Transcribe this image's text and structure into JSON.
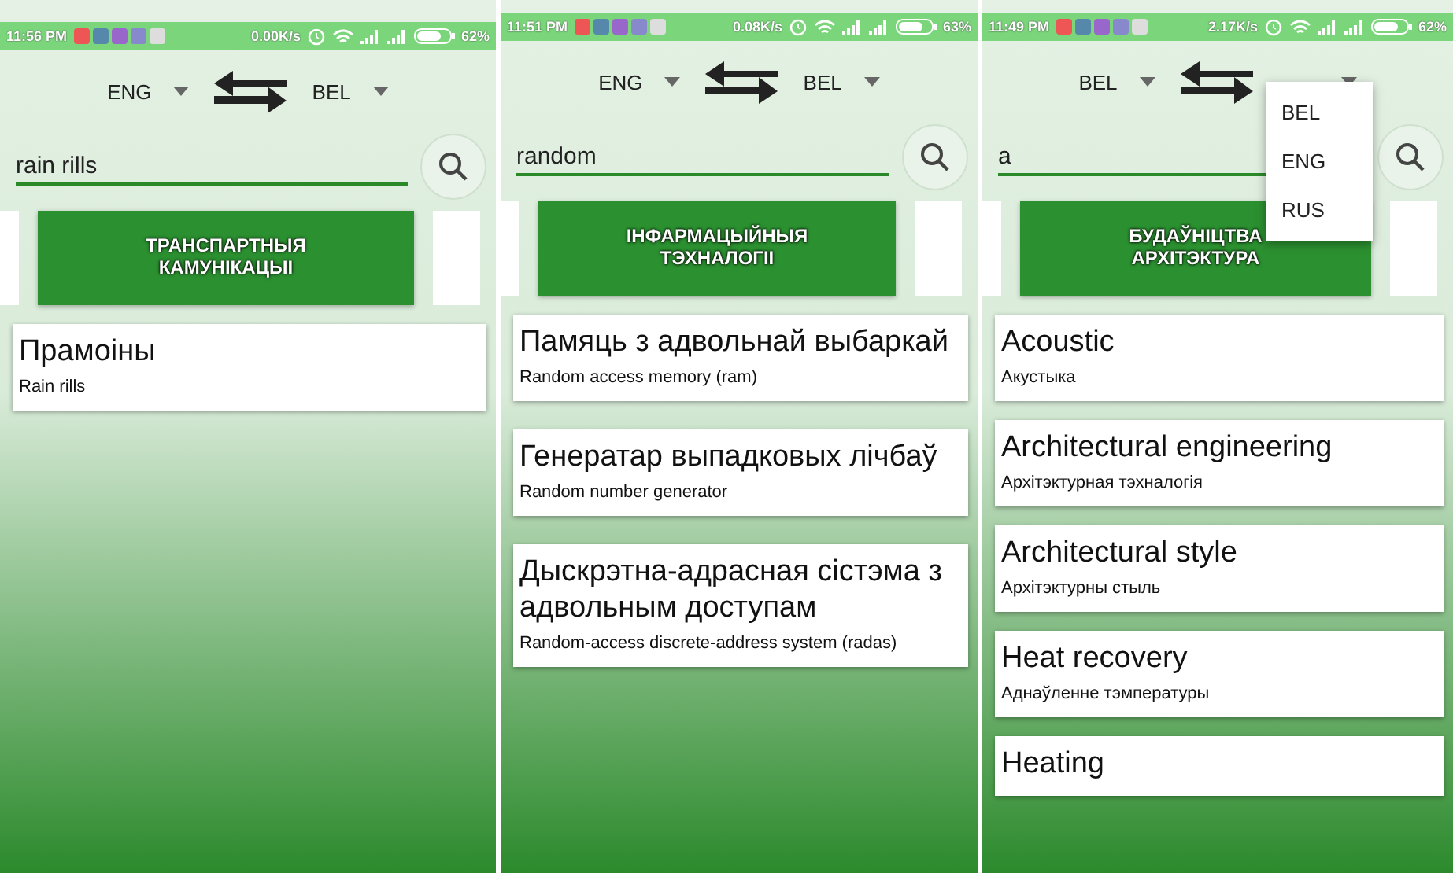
{
  "screens": [
    {
      "status_bar": {
        "time": "11:56 PM",
        "speed": "0.00K/s",
        "battery": "62%"
      },
      "from_language": "ENG",
      "to_language": "BEL",
      "search": {
        "value": "rain rills"
      },
      "category": "ТРАНСПАРТНЫЯ КАМУНІКАЦЫІ",
      "results": [
        {
          "term": "Прамоіны",
          "translation": "Rain rills"
        }
      ]
    },
    {
      "status_bar": {
        "time": "11:51 PM",
        "speed": "0.08K/s",
        "battery": "63%"
      },
      "from_language": "ENG",
      "to_language": "BEL",
      "search": {
        "value": "random"
      },
      "category": "ІНФАРМАЦЫЙНЫЯ ТЭХНАЛОГІІ",
      "results": [
        {
          "term": "Памяць з адвольнай выбаркай",
          "translation": "Random access memory (ram)"
        },
        {
          "term": "Генератар выпадковых лічбаў",
          "translation": "Random number generator"
        },
        {
          "term": "Дыскрэтна-адрасная сістэма з адвольным доступам",
          "translation": "Random-access discrete-address system (radas)"
        }
      ]
    },
    {
      "status_bar": {
        "time": "11:49 PM",
        "speed": "2.17K/s",
        "battery": "62%"
      },
      "from_language": "BEL",
      "language_menu": [
        "BEL",
        "ENG",
        "RUS"
      ],
      "search": {
        "value": "a"
      },
      "category": "БУДАЎНІЦТВА АРХІТЭКТУРА",
      "results": [
        {
          "term": "Acoustic",
          "translation": "Акустыка"
        },
        {
          "term": "Architectural engineering",
          "translation": "Архітэктурная тэхналогія"
        },
        {
          "term": "Architectural style",
          "translation": "Архітэктурны стыль"
        },
        {
          "term": "Heat recovery",
          "translation": "Аднаўленне тэмпературы"
        },
        {
          "term": "Heating"
        }
      ]
    }
  ]
}
